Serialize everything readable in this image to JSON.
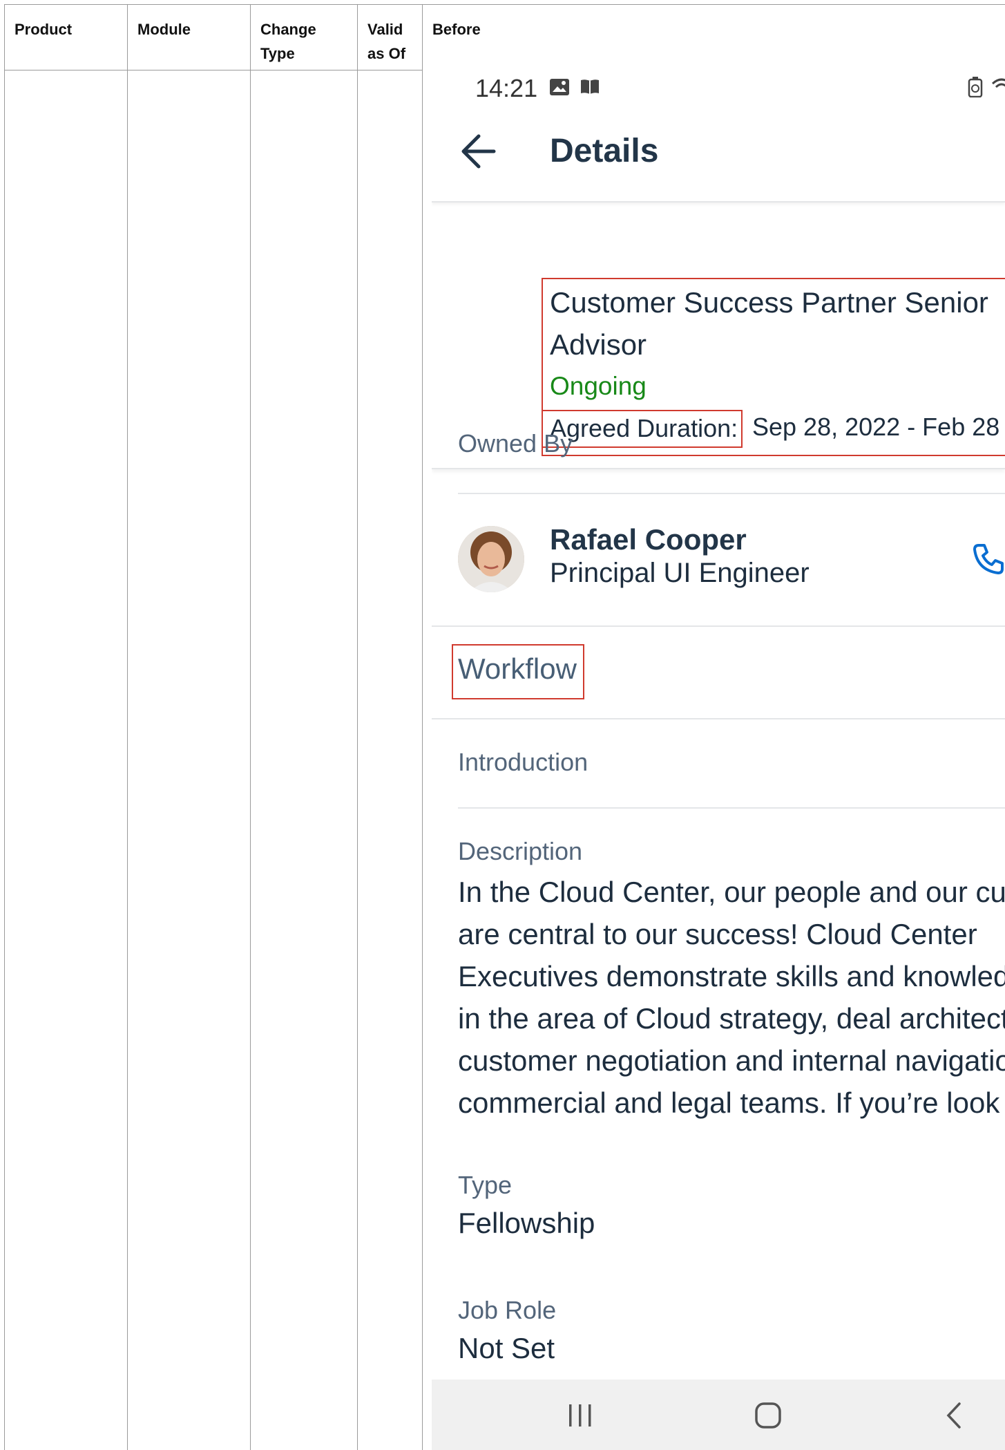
{
  "table": {
    "headers": [
      "Product",
      "Module",
      "Change Type",
      "Valid as Of",
      "Before"
    ],
    "header_lines": {
      "product": [
        "Product"
      ],
      "module": [
        "Module"
      ],
      "change_type": [
        "Change",
        "Type"
      ],
      "valid_as_of": [
        "Valid",
        "as Of"
      ],
      "before": [
        "Before"
      ]
    }
  },
  "phone": {
    "status": {
      "time": "14:21"
    },
    "app_title": "Details",
    "header": {
      "title_line1": "Customer Success Partner Senior",
      "title_line2": "Advisor",
      "status": "Ongoing",
      "agreed_duration_label": "Agreed Duration:",
      "agreed_duration_value": "Sep 28, 2022 - Feb 28"
    },
    "owned_by_label": "Owned By",
    "owner": {
      "name": "Rafael Cooper",
      "role": "Principal UI Engineer"
    },
    "workflow_label": "Workflow",
    "introduction_label": "Introduction",
    "description_label": "Description",
    "description_lines": [
      "In the Cloud Center, our people and our cu",
      "are central to our success! Cloud Center",
      "Executives demonstrate skills and knowled",
      "in the area of Cloud strategy, deal architect",
      "customer negotiation and internal navigatio",
      "commercial and legal teams.  If you’re look"
    ],
    "type_label": "Type",
    "type_value": "Fellowship",
    "job_role_label": "Job Role",
    "job_role_value": "Not Set"
  },
  "colors": {
    "accent_red": "#d03a2e",
    "status_green": "#188918",
    "phone_blue": "#0a6ed1"
  }
}
